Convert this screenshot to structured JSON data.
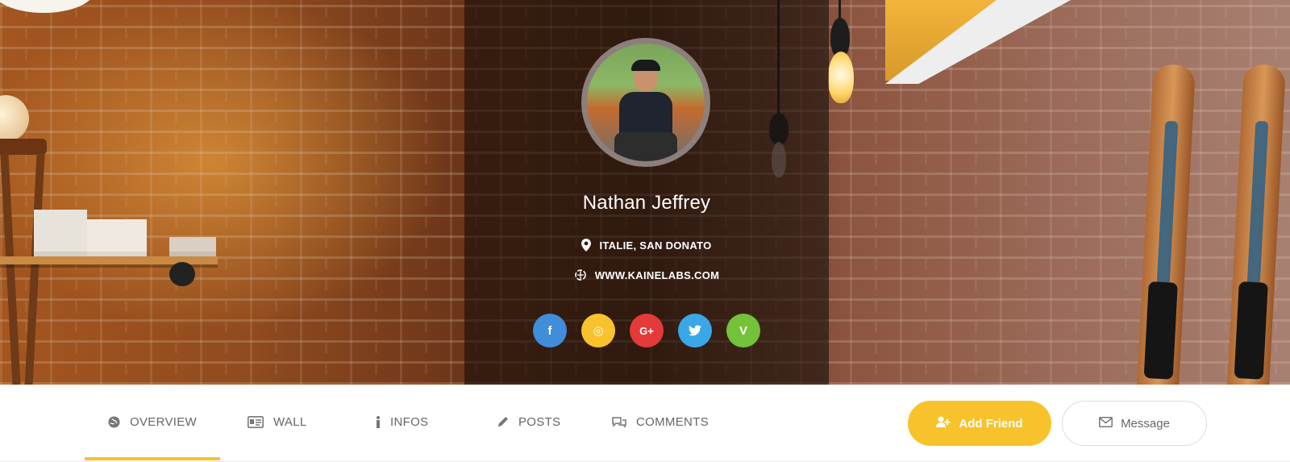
{
  "profile": {
    "name": "Nathan Jeffrey",
    "location": "ITALIE, SAN DONATO",
    "website": "WWW.KAINELABS.COM"
  },
  "socials": [
    {
      "icon": "facebook-icon",
      "glyph": "f",
      "color": "#3f8ddb"
    },
    {
      "icon": "instagram-icon",
      "glyph": "◎",
      "color": "#f7c22c"
    },
    {
      "icon": "google-plus-icon",
      "glyph": "G+",
      "color": "#e53a3a"
    },
    {
      "icon": "twitter-icon",
      "glyph": "🐦",
      "color": "#3aa7e6"
    },
    {
      "icon": "vine-icon",
      "glyph": "V",
      "color": "#73c23a"
    }
  ],
  "tabs": {
    "overview": "OVERVIEW",
    "wall": "WALL",
    "infos": "INFOS",
    "posts": "POSTS",
    "comments": "COMMENTS",
    "active": "OVERVIEW"
  },
  "actions": {
    "add_friend": "Add Friend",
    "message": "Message"
  },
  "colors": {
    "accent": "#f7c22c",
    "tab_text": "#666666"
  }
}
